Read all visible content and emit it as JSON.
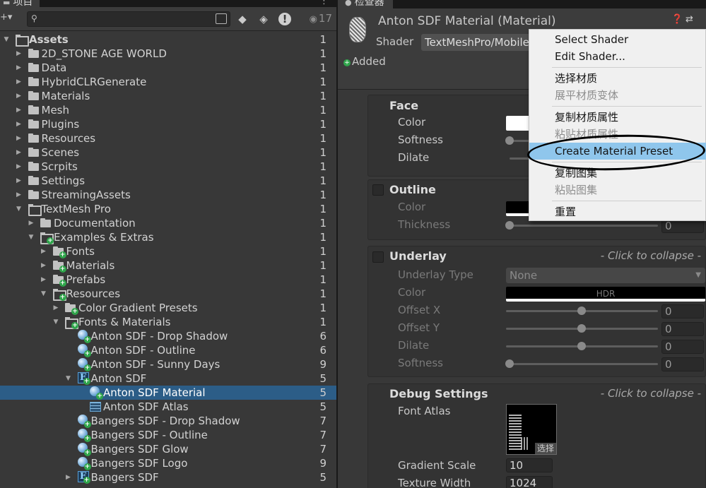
{
  "project": {
    "tab_label": "项目",
    "tab_menu": "⋮",
    "create_button": "+▾",
    "search_placeholder": "",
    "visibility_count": "17",
    "colors": {
      "panel_bg": "#383838",
      "selection": "#2c5d87"
    },
    "tree": [
      {
        "label": "Assets",
        "count": "1",
        "depth": 0,
        "arrow": "down",
        "icon": "folder-open-icon",
        "bold": true
      },
      {
        "label": "2D_STONE AGE WORLD",
        "count": "1",
        "depth": 1,
        "arrow": "right",
        "icon": "folder-icon"
      },
      {
        "label": "Data",
        "count": "1",
        "depth": 1,
        "arrow": "right",
        "icon": "folder-icon"
      },
      {
        "label": "HybridCLRGenerate",
        "count": "1",
        "depth": 1,
        "arrow": "right",
        "icon": "folder-icon"
      },
      {
        "label": "Materials",
        "count": "1",
        "depth": 1,
        "arrow": "right",
        "icon": "folder-icon"
      },
      {
        "label": "Mesh",
        "count": "1",
        "depth": 1,
        "arrow": "right",
        "icon": "folder-icon"
      },
      {
        "label": "Plugins",
        "count": "1",
        "depth": 1,
        "arrow": "right",
        "icon": "folder-icon"
      },
      {
        "label": "Resources",
        "count": "1",
        "depth": 1,
        "arrow": "right",
        "icon": "folder-icon"
      },
      {
        "label": "Scenes",
        "count": "1",
        "depth": 1,
        "arrow": "right",
        "icon": "folder-icon"
      },
      {
        "label": "Scrpits",
        "count": "1",
        "depth": 1,
        "arrow": "right",
        "icon": "folder-icon"
      },
      {
        "label": "Settings",
        "count": "1",
        "depth": 1,
        "arrow": "right",
        "icon": "folder-icon"
      },
      {
        "label": "StreamingAssets",
        "count": "1",
        "depth": 1,
        "arrow": "right",
        "icon": "folder-icon"
      },
      {
        "label": "TextMesh Pro",
        "count": "1",
        "depth": 1,
        "arrow": "down",
        "icon": "folder-open-icon"
      },
      {
        "label": "Documentation",
        "count": "1",
        "depth": 2,
        "arrow": "right",
        "icon": "folder-icon"
      },
      {
        "label": "Examples & Extras",
        "count": "1",
        "depth": 2,
        "arrow": "down",
        "icon": "folder-open-added-icon"
      },
      {
        "label": "Fonts",
        "count": "1",
        "depth": 3,
        "arrow": "right",
        "icon": "folder-added-icon"
      },
      {
        "label": "Materials",
        "count": "1",
        "depth": 3,
        "arrow": "right",
        "icon": "folder-added-icon"
      },
      {
        "label": "Prefabs",
        "count": "1",
        "depth": 3,
        "arrow": "right",
        "icon": "folder-added-icon"
      },
      {
        "label": "Resources",
        "count": "1",
        "depth": 3,
        "arrow": "down",
        "icon": "folder-open-added-icon"
      },
      {
        "label": "Color Gradient Presets",
        "count": "1",
        "depth": 4,
        "arrow": "right",
        "icon": "folder-added-icon"
      },
      {
        "label": "Fonts & Materials",
        "count": "1",
        "depth": 4,
        "arrow": "down",
        "icon": "folder-open-added-icon"
      },
      {
        "label": "Anton SDF - Drop Shadow",
        "count": "6",
        "depth": 5,
        "arrow": "",
        "icon": "material-added-icon"
      },
      {
        "label": "Anton SDF - Outline",
        "count": "6",
        "depth": 5,
        "arrow": "",
        "icon": "material-added-icon"
      },
      {
        "label": "Anton SDF - Sunny Days",
        "count": "9",
        "depth": 5,
        "arrow": "",
        "icon": "material-added-icon"
      },
      {
        "label": "Anton SDF",
        "count": "5",
        "depth": 5,
        "arrow": "down",
        "icon": "font-asset-added-icon"
      },
      {
        "label": "Anton SDF Material",
        "count": "5",
        "depth": 6,
        "arrow": "",
        "icon": "material-added-icon",
        "selected": true
      },
      {
        "label": "Anton SDF Atlas",
        "count": "5",
        "depth": 6,
        "arrow": "",
        "icon": "texture-atlas-icon"
      },
      {
        "label": "Bangers SDF - Drop Shadow",
        "count": "7",
        "depth": 5,
        "arrow": "",
        "icon": "material-added-icon"
      },
      {
        "label": "Bangers SDF - Outline",
        "count": "7",
        "depth": 5,
        "arrow": "",
        "icon": "material-added-icon"
      },
      {
        "label": "Bangers SDF Glow",
        "count": "7",
        "depth": 5,
        "arrow": "",
        "icon": "material-added-icon"
      },
      {
        "label": "Bangers SDF Logo",
        "count": "9",
        "depth": 5,
        "arrow": "",
        "icon": "material-added-icon"
      },
      {
        "label": "Bangers SDF",
        "count": "5",
        "depth": 5,
        "arrow": "right",
        "icon": "font-asset-added-icon"
      }
    ]
  },
  "inspector": {
    "tab_label": "检查器",
    "title": "Anton SDF Material (Material)",
    "shader_label": "Shader",
    "shader_value": "TextMeshPro/Mobile",
    "added_label": "Added",
    "face": {
      "title": "Face",
      "color_label": "Color",
      "softness_label": "Softness",
      "dilate_label": "Dilate"
    },
    "outline": {
      "title": "Outline",
      "color_label": "Color",
      "thickness_label": "Thickness",
      "thickness_value": "0"
    },
    "underlay": {
      "title": "Underlay",
      "hint": "- Click to collapse -",
      "type_label": "Underlay Type",
      "type_value": "None",
      "color_label": "Color",
      "hdr_label": "HDR",
      "offset_x_label": "Offset X",
      "offset_x_value": "0",
      "offset_y_label": "Offset Y",
      "offset_y_value": "0",
      "dilate_label": "Dilate",
      "dilate_value": "0",
      "softness_label": "Softness",
      "softness_value": "0"
    },
    "debug": {
      "title": "Debug Settings",
      "hint": "- Click to collapse -",
      "font_atlas_label": "Font Atlas",
      "atlas_select": "选择",
      "gradient_scale_label": "Gradient Scale",
      "gradient_scale_value": "10",
      "texture_width_label": "Texture Width",
      "texture_width_value": "1024"
    }
  },
  "context_menu": {
    "items": [
      {
        "label": "Select Shader",
        "enabled": true
      },
      {
        "label": "Edit Shader...",
        "enabled": true
      },
      {
        "label": "选择材质",
        "enabled": true
      },
      {
        "label": "展平材质变体",
        "enabled": false
      },
      {
        "label": "复制材质属性",
        "enabled": true
      },
      {
        "label": "粘贴材质属性",
        "enabled": false
      },
      {
        "label": "Create Material Preset",
        "enabled": true,
        "highlighted": true
      },
      {
        "label": "复制图集",
        "enabled": true
      },
      {
        "label": "粘贴图集",
        "enabled": false
      },
      {
        "label": "重置",
        "enabled": true
      }
    ],
    "highlight_color": "#8fc6ec"
  }
}
